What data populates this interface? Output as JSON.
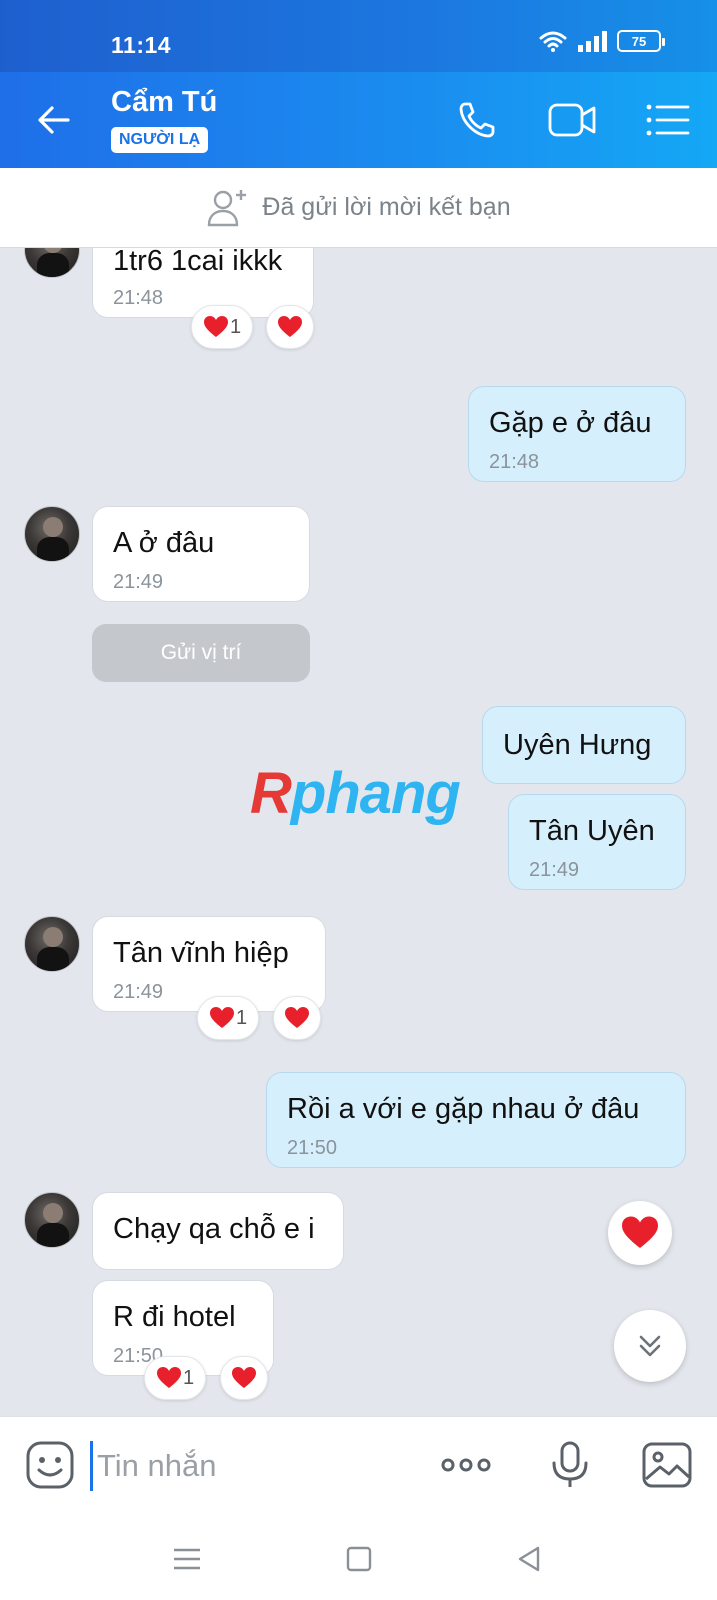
{
  "status_bar": {
    "time": "11:14",
    "battery": "75"
  },
  "header": {
    "contact_name": "Cẩm Tú",
    "tag": "NGƯỜI LẠ",
    "icons": [
      "back-arrow-icon",
      "phone-icon",
      "video-camera-icon",
      "list-menu-icon"
    ]
  },
  "friend_request": {
    "text": "Đã gửi lời mời kết bạn"
  },
  "messages": [
    {
      "side": "in",
      "text": "1tr6 1cai ikkk",
      "time": "21:48",
      "reaction_count": "1"
    },
    {
      "side": "out",
      "text": "Gặp e ở đâu",
      "time": "21:48"
    },
    {
      "side": "in",
      "text": "A ở đâu",
      "time": "21:49"
    },
    {
      "side": "in",
      "action": "Gửi vị trí"
    },
    {
      "side": "out",
      "text": "Uyên Hưng"
    },
    {
      "side": "out",
      "text": "Tân Uyên",
      "time": "21:49"
    },
    {
      "side": "in",
      "text": "Tân vĩnh hiệp",
      "time": "21:49",
      "reaction_count": "1"
    },
    {
      "side": "out",
      "text": "Rồi a với e gặp nhau ở đâu",
      "time": "21:50"
    },
    {
      "side": "in",
      "text": "Chạy qa chỗ e i"
    },
    {
      "side": "in",
      "text": "R đi hotel",
      "time": "21:50",
      "reaction_count": "1"
    }
  ],
  "watermark": {
    "first": "R",
    "rest": "phang"
  },
  "input_bar": {
    "placeholder": "Tin nhắn"
  },
  "colors": {
    "header_blue": "#1a8ef0",
    "outgoing_bubble": "#d6effc",
    "incoming_bubble": "#ffffff",
    "chat_background": "#e3e7ed",
    "heart_red": "#e8202c"
  }
}
